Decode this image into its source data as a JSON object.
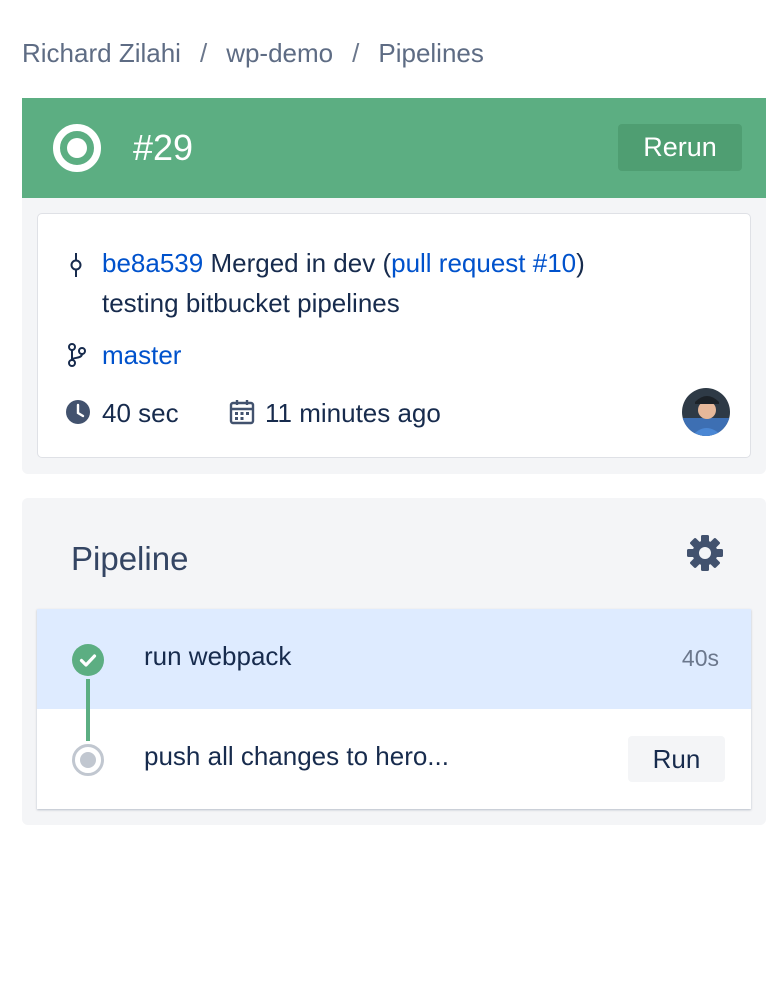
{
  "breadcrumb": {
    "owner": "Richard Zilahi",
    "repo": "wp-demo",
    "section": "Pipelines",
    "separator": "/"
  },
  "header": {
    "build_number": "#29",
    "rerun_label": "Rerun",
    "status_color": "#5cae82"
  },
  "commit": {
    "hash": "be8a539",
    "message_prefix": " Merged in dev (",
    "pr_link": "pull request #10",
    "message_suffix": ")",
    "message_line2": "testing bitbucket pipelines",
    "branch": "master",
    "duration": "40 sec",
    "time_ago": "11 minutes ago",
    "icons": {
      "commit": "commit-icon",
      "branch": "branch-icon",
      "duration": "clock-icon",
      "date": "calendar-icon",
      "author": "avatar"
    }
  },
  "pipeline": {
    "title": "Pipeline",
    "settings_icon": "gear-icon",
    "steps": [
      {
        "label": "run webpack",
        "duration": "40s",
        "status": "success"
      },
      {
        "label": "push all changes to hero...",
        "action_label": "Run",
        "status": "pending"
      }
    ]
  },
  "colors": {
    "success": "#5cae82",
    "link": "#0052cc",
    "selected_row": "#deebff"
  }
}
